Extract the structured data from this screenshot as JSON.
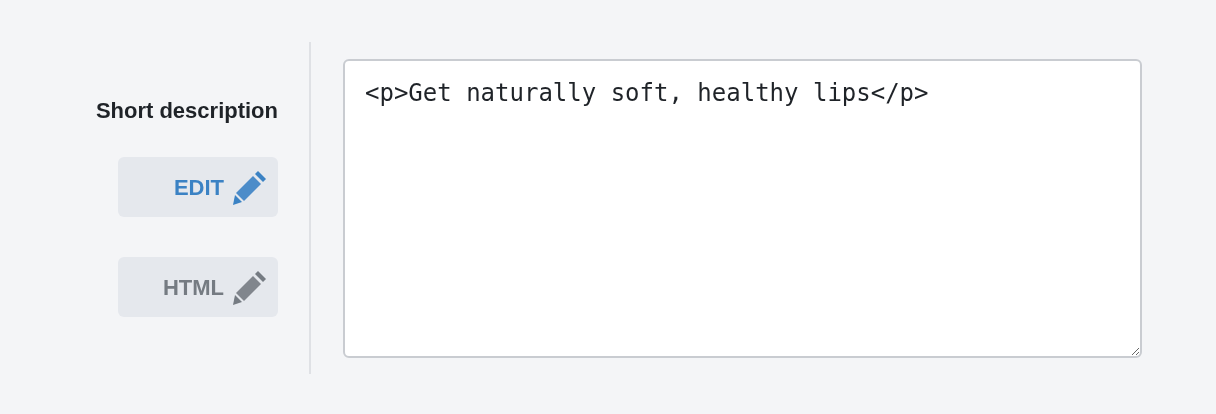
{
  "field_label": "Short description",
  "modes": [
    {
      "label": "EDIT",
      "selected": true
    },
    {
      "label": "HTML",
      "selected": false
    }
  ],
  "editor": {
    "value": "<p>Get naturally soft, healthy lips</p>"
  }
}
